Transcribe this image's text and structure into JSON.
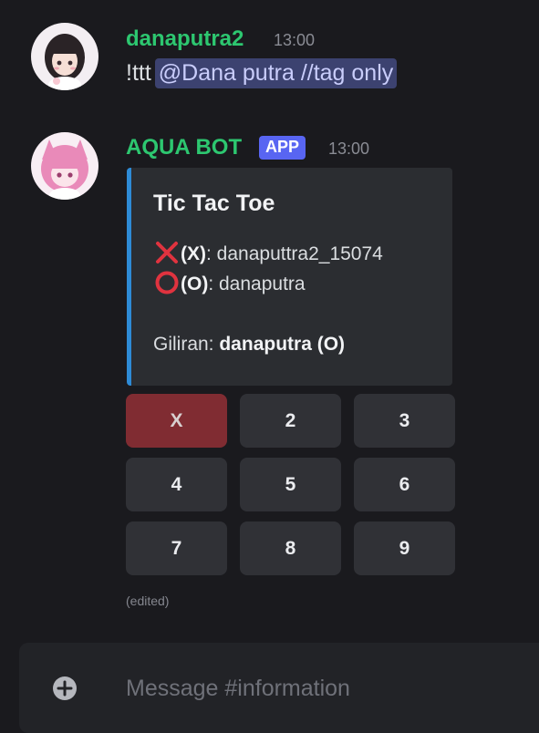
{
  "messages": [
    {
      "author": "danaputra2",
      "timestamp": "13:00",
      "author_color": "#2dc770",
      "text": "!ttt",
      "mention": "@Dana putra //tag only"
    },
    {
      "author": "AQUA BOT",
      "badge": "APP",
      "timestamp": "13:00",
      "author_color": "#2dc770",
      "embed": {
        "title": "Tic Tac Toe",
        "player_x_mark": "(X)",
        "player_x_name": ": danaputtra2_15074",
        "player_o_mark": "(O)",
        "player_o_name": ": danaputra",
        "turn_label": "Giliran: ",
        "turn_value": "danaputra (O)",
        "accent_color": "#2e8bd6"
      },
      "board": [
        "X",
        "2",
        "3",
        "4",
        "5",
        "6",
        "7",
        "8",
        "9"
      ],
      "edited_label": "(edited)"
    }
  ],
  "composer": {
    "placeholder": "Message #information"
  },
  "icons": {
    "player_x": "cross-mark-icon",
    "player_o": "hollow-circle-icon",
    "add": "plus-circle-icon"
  }
}
